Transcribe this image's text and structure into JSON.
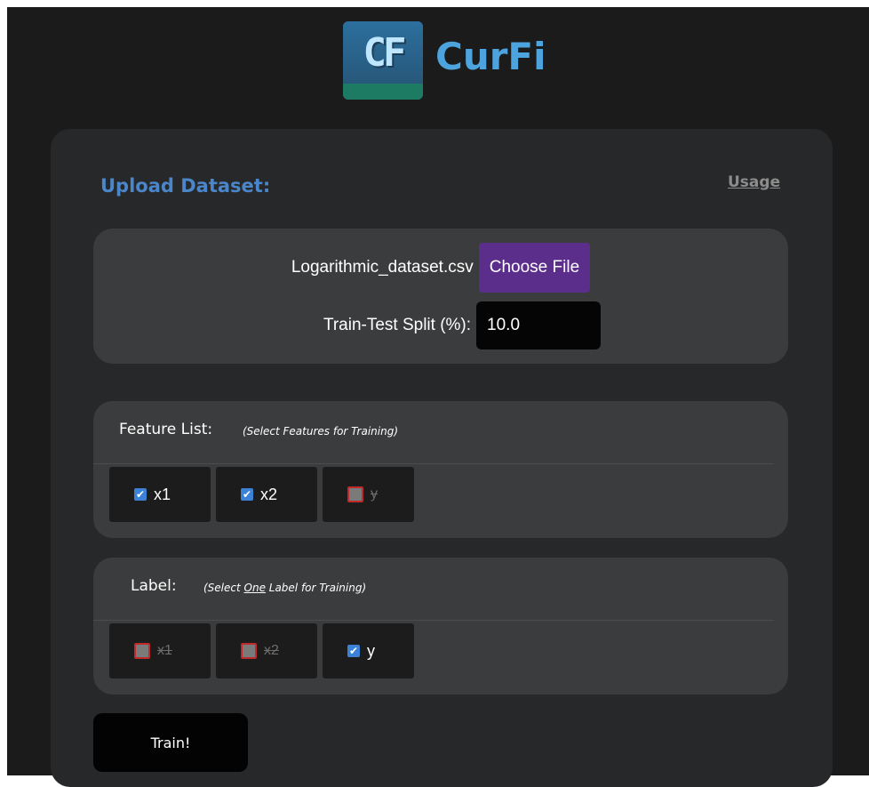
{
  "header": {
    "logo_text": "CF",
    "title": "CurFi"
  },
  "upload": {
    "heading": "Upload Dataset:",
    "usage_link": "Usage",
    "file_name": "Logarithmic_dataset.csv",
    "choose_file_label": "Choose File",
    "split_label": "Train-Test Split (%):",
    "split_value": "10.0"
  },
  "features": {
    "title": "Feature List:",
    "hint": "(Select Features for Training)",
    "items": [
      {
        "label": "x1",
        "state": "checked"
      },
      {
        "label": "x2",
        "state": "checked"
      },
      {
        "label": "y",
        "state": "disabled"
      }
    ]
  },
  "labels": {
    "title": "Label:",
    "hint_before": "(Select ",
    "hint_emph": "One",
    "hint_after": " Label for Training)",
    "items": [
      {
        "label": "x1",
        "state": "disabled"
      },
      {
        "label": "x2",
        "state": "disabled"
      },
      {
        "label": "y",
        "state": "checked"
      }
    ]
  },
  "train_button": "Train!",
  "colors": {
    "background": "#1b1b1b",
    "card": "#272829",
    "panel": "#3b3c3d",
    "accent_blue": "#4a86c9",
    "choose_button": "#5b2e8c",
    "checkbox_checked": "#3b82d6",
    "disabled_border": "#c02a2a"
  }
}
